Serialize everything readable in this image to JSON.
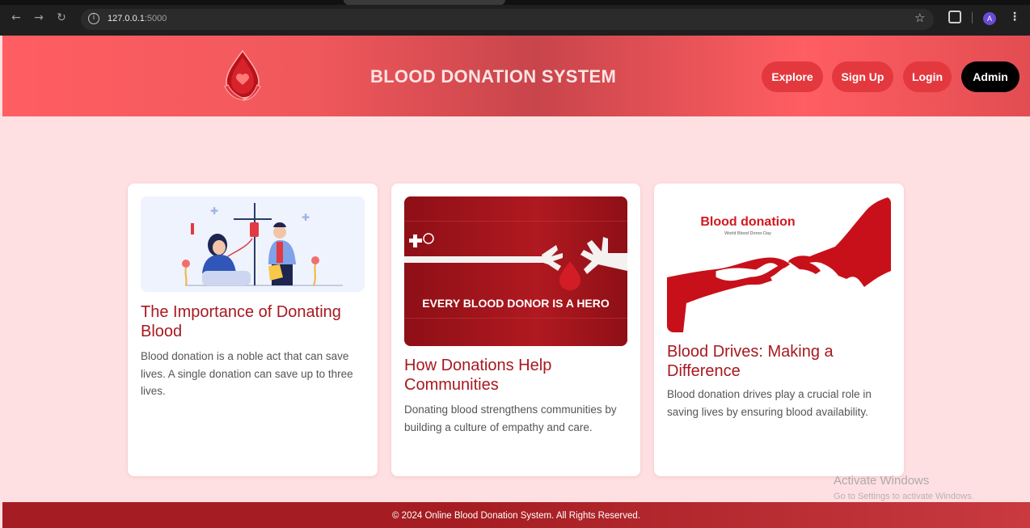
{
  "browser": {
    "url_host": "127.0.0.1",
    "url_port": ":5000",
    "profile_initial": "A"
  },
  "header": {
    "title": "BLOOD DONATION SYSTEM",
    "nav": {
      "explore": "Explore",
      "signup": "Sign Up",
      "login": "Login",
      "admin": "Admin"
    }
  },
  "cards": [
    {
      "title": "The Importance of Donating Blood",
      "text": "Blood donation is a noble act that can save lives. A single donation can save up to three lives."
    },
    {
      "title": "How Donations Help Communities",
      "text": "Donating blood strengthens communities by building a culture of empathy and care.",
      "image_text": "EVERY BLOOD DONOR IS A HERO"
    },
    {
      "title": "Blood Drives: Making a Difference",
      "text": "Blood donation drives play a crucial role in saving lives by ensuring blood availability.",
      "image_title": "Blood donation",
      "image_subtitle": "World Blood Donor Day"
    }
  ],
  "watermark": {
    "line1": "Activate Windows",
    "line2": "Go to Settings to activate Windows."
  },
  "footer": {
    "text": "© 2024 Online Blood Donation System. All Rights Reserved."
  },
  "colors": {
    "header_accent": "#ff5e62",
    "pill": "#e4383f",
    "admin_pill": "#000000",
    "card_title": "#a8191f",
    "page_bg": "#ffe0e2",
    "footer_bg": "#a51d22"
  }
}
